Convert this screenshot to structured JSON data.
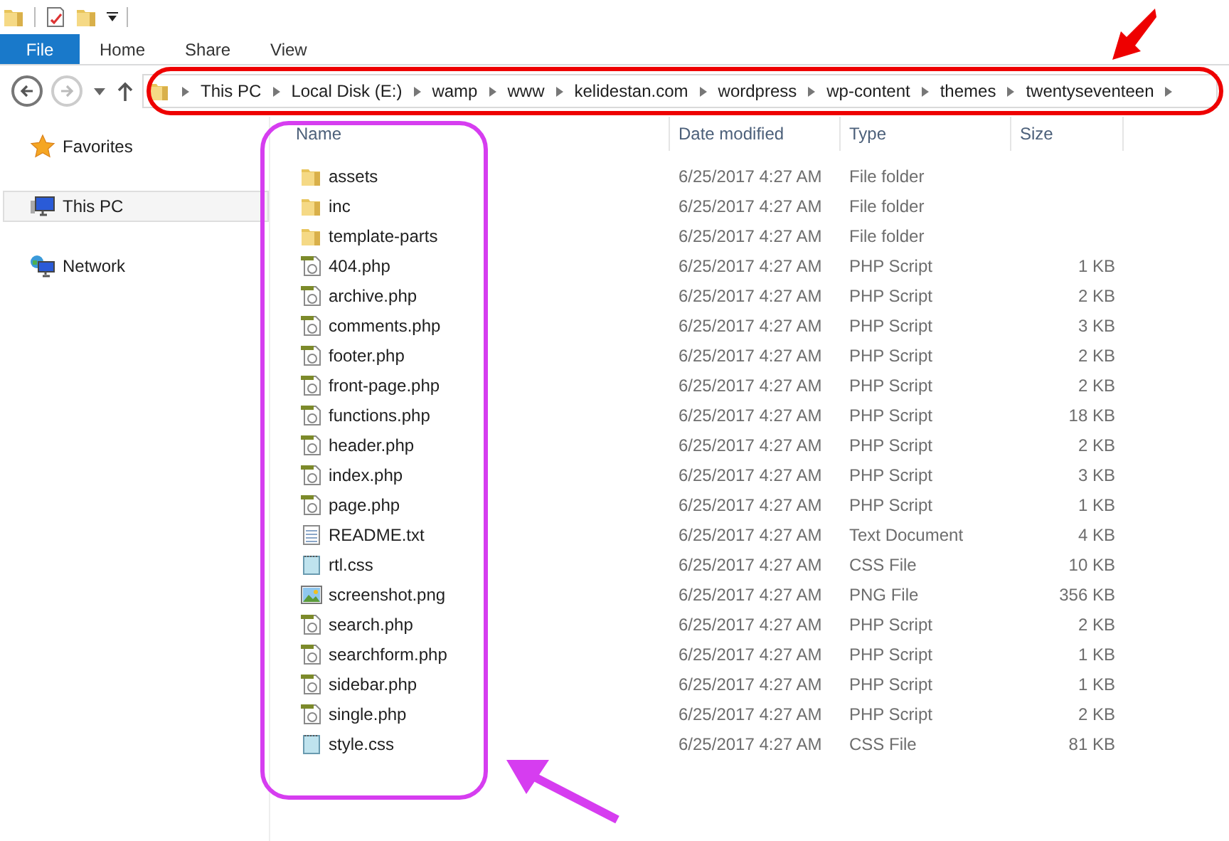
{
  "ribbon_tabs": [
    {
      "label": "File",
      "selected": true
    },
    {
      "label": "Home",
      "selected": false
    },
    {
      "label": "Share",
      "selected": false
    },
    {
      "label": "View",
      "selected": false
    }
  ],
  "address_bar": {
    "crumbs": [
      "This PC",
      "Local Disk (E:)",
      "wamp",
      "www",
      "kelidestan.com",
      "wordpress",
      "wp-content",
      "themes",
      "twentyseventeen"
    ]
  },
  "sidebar": {
    "items": [
      {
        "label": "Favorites",
        "kind": "favorites",
        "selected": false
      },
      {
        "label": "This PC",
        "kind": "pc",
        "selected": true
      },
      {
        "label": "Network",
        "kind": "network",
        "selected": false
      }
    ]
  },
  "table": {
    "columns": [
      "Name",
      "Date modified",
      "Type",
      "Size"
    ],
    "rows": [
      {
        "name": "assets",
        "date": "6/25/2017 4:27 AM",
        "type": "File folder",
        "kind": "folder"
      },
      {
        "name": "inc",
        "date": "6/25/2017 4:27 AM",
        "type": "File folder",
        "kind": "folder"
      },
      {
        "name": "template-parts",
        "date": "6/25/2017 4:27 AM",
        "type": "File folder",
        "kind": "folder"
      },
      {
        "name": "404.php",
        "date": "6/25/2017 4:27 AM",
        "type": "PHP Script",
        "size": "1 KB",
        "kind": "php"
      },
      {
        "name": "archive.php",
        "date": "6/25/2017 4:27 AM",
        "type": "PHP Script",
        "size": "2 KB",
        "kind": "php"
      },
      {
        "name": "comments.php",
        "date": "6/25/2017 4:27 AM",
        "type": "PHP Script",
        "size": "3 KB",
        "kind": "php"
      },
      {
        "name": "footer.php",
        "date": "6/25/2017 4:27 AM",
        "type": "PHP Script",
        "size": "2 KB",
        "kind": "php"
      },
      {
        "name": "front-page.php",
        "date": "6/25/2017 4:27 AM",
        "type": "PHP Script",
        "size": "2 KB",
        "kind": "php"
      },
      {
        "name": "functions.php",
        "date": "6/25/2017 4:27 AM",
        "type": "PHP Script",
        "size": "18 KB",
        "kind": "php"
      },
      {
        "name": "header.php",
        "date": "6/25/2017 4:27 AM",
        "type": "PHP Script",
        "size": "2 KB",
        "kind": "php"
      },
      {
        "name": "index.php",
        "date": "6/25/2017 4:27 AM",
        "type": "PHP Script",
        "size": "3 KB",
        "kind": "php"
      },
      {
        "name": "page.php",
        "date": "6/25/2017 4:27 AM",
        "type": "PHP Script",
        "size": "1 KB",
        "kind": "php"
      },
      {
        "name": "README.txt",
        "date": "6/25/2017 4:27 AM",
        "type": "Text Document",
        "size": "4 KB",
        "kind": "txt"
      },
      {
        "name": "rtl.css",
        "date": "6/25/2017 4:27 AM",
        "type": "CSS File",
        "size": "10 KB",
        "kind": "css"
      },
      {
        "name": "screenshot.png",
        "date": "6/25/2017 4:27 AM",
        "type": "PNG File",
        "size": "356 KB",
        "kind": "png"
      },
      {
        "name": "search.php",
        "date": "6/25/2017 4:27 AM",
        "type": "PHP Script",
        "size": "2 KB",
        "kind": "php"
      },
      {
        "name": "searchform.php",
        "date": "6/25/2017 4:27 AM",
        "type": "PHP Script",
        "size": "1 KB",
        "kind": "php"
      },
      {
        "name": "sidebar.php",
        "date": "6/25/2017 4:27 AM",
        "type": "PHP Script",
        "size": "1 KB",
        "kind": "php"
      },
      {
        "name": "single.php",
        "date": "6/25/2017 4:27 AM",
        "type": "PHP Script",
        "size": "2 KB",
        "kind": "php"
      },
      {
        "name": "style.css",
        "date": "6/25/2017 4:27 AM",
        "type": "CSS File",
        "size": "81 KB",
        "kind": "css"
      }
    ]
  }
}
